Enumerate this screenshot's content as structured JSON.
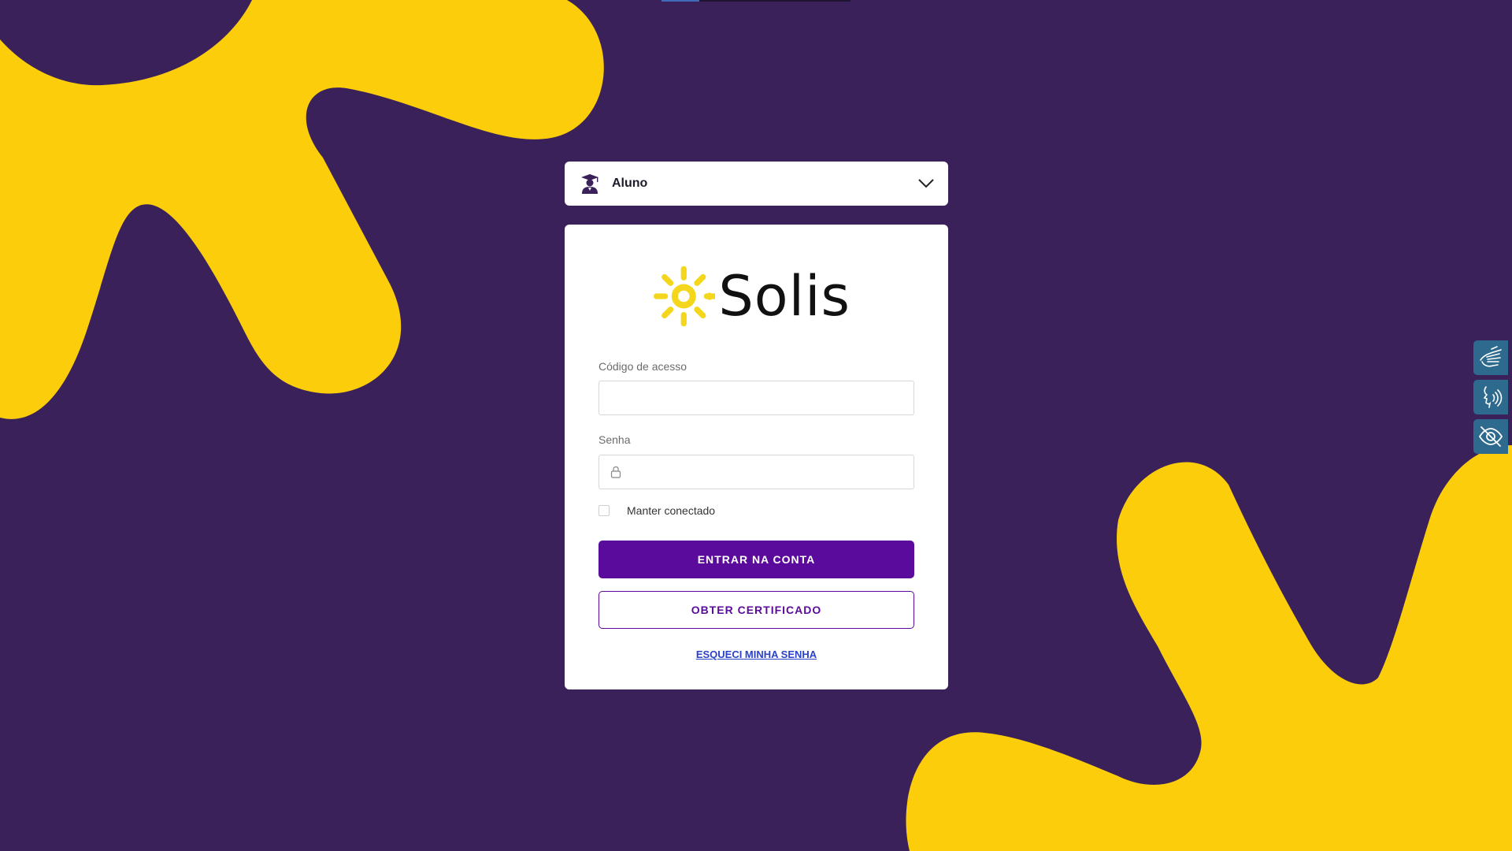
{
  "profile_select": {
    "selected": "Aluno",
    "icon": "student-icon"
  },
  "brand": {
    "name": "Solis",
    "logo_icon": "sun-icon",
    "colors": {
      "background": "#3a2159",
      "blob": "#fbcd0b",
      "primary": "#5b0b9b",
      "link": "#2a41c9",
      "sun": "#f4d61c"
    }
  },
  "form": {
    "access_code_label": "Código de acesso",
    "access_code_value": "",
    "password_label": "Senha",
    "password_value": "",
    "remember_label": "Manter conectado",
    "remember_checked": false,
    "submit_label": "ENTRAR NA CONTA",
    "certificate_label": "OBTER CERTIFICADO",
    "forgot_label": "ESQUECI MINHA SENHA"
  },
  "accessibility": {
    "items": [
      {
        "icon": "sign-language-icon"
      },
      {
        "icon": "audio-description-icon"
      },
      {
        "icon": "low-vision-icon"
      }
    ]
  }
}
